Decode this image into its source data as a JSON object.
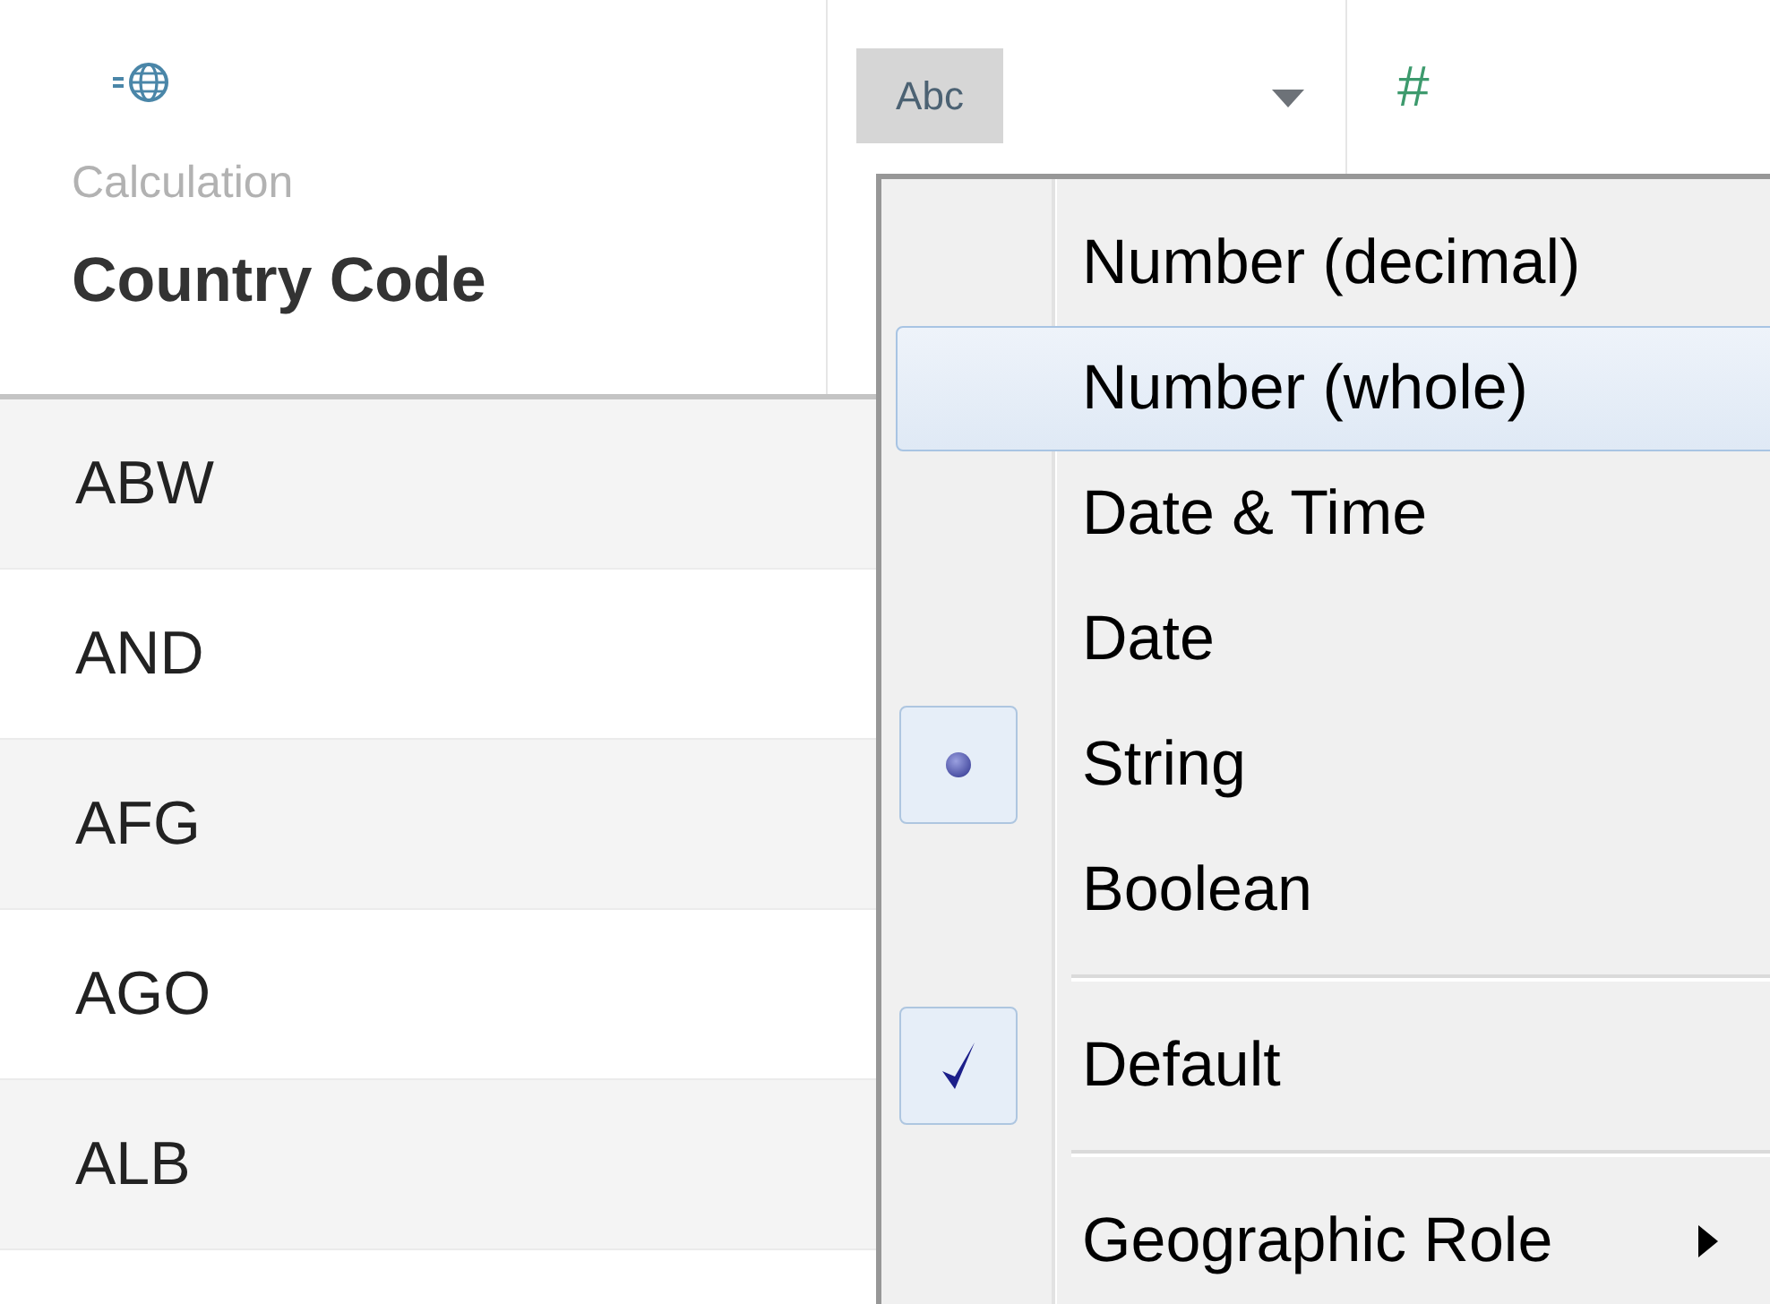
{
  "header": {
    "columns": [
      {
        "kind": "calc",
        "subtitle": "Calculation",
        "title": "Country Code"
      },
      {
        "kind": "type",
        "badge": "Abc"
      },
      {
        "kind": "number",
        "symbol": "#"
      }
    ]
  },
  "rows": [
    {
      "value": "ABW"
    },
    {
      "value": "AND"
    },
    {
      "value": "AFG"
    },
    {
      "value": "AGO"
    },
    {
      "value": "ALB"
    }
  ],
  "menu": {
    "items": [
      {
        "kind": "item",
        "label": "Number (decimal)",
        "selected": false,
        "radio": false,
        "checked": false,
        "submenu": false
      },
      {
        "kind": "item",
        "label": "Number (whole)",
        "selected": true,
        "radio": false,
        "checked": false,
        "submenu": false
      },
      {
        "kind": "item",
        "label": "Date & Time",
        "selected": false,
        "radio": false,
        "checked": false,
        "submenu": false
      },
      {
        "kind": "item",
        "label": "Date",
        "selected": false,
        "radio": false,
        "checked": false,
        "submenu": false
      },
      {
        "kind": "item",
        "label": "String",
        "selected": false,
        "radio": true,
        "checked": false,
        "submenu": false
      },
      {
        "kind": "item",
        "label": "Boolean",
        "selected": false,
        "radio": false,
        "checked": false,
        "submenu": false
      },
      {
        "kind": "separator"
      },
      {
        "kind": "item",
        "label": "Default",
        "selected": false,
        "radio": false,
        "checked": true,
        "submenu": false
      },
      {
        "kind": "separator"
      },
      {
        "kind": "item",
        "label": "Geographic Role",
        "selected": false,
        "radio": false,
        "checked": false,
        "submenu": true
      }
    ]
  }
}
